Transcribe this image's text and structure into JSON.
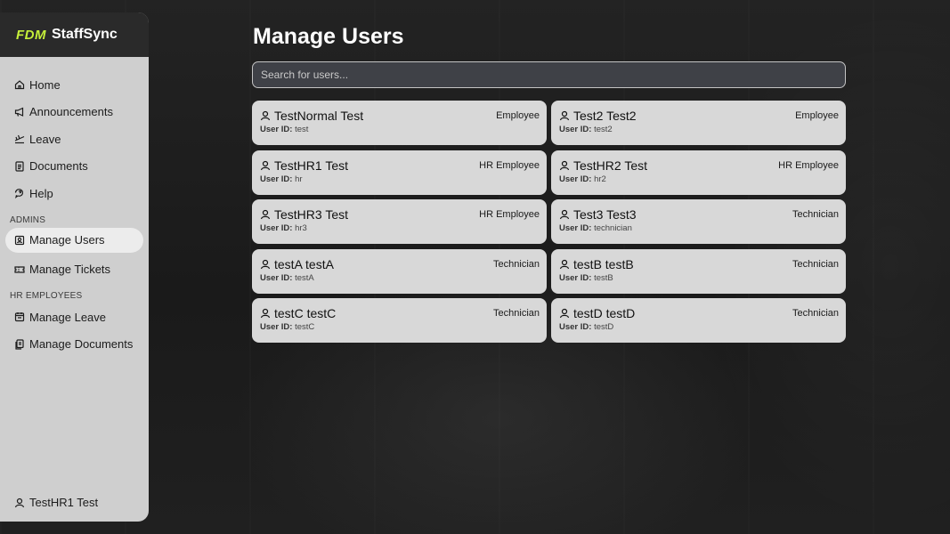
{
  "brand": {
    "logo": "FDM",
    "name": "StaffSync",
    "logo_color": "#c6f03a"
  },
  "sidebar": {
    "main_items": [
      {
        "label": "Home",
        "icon": "home-icon"
      },
      {
        "label": "Announcements",
        "icon": "megaphone-icon"
      },
      {
        "label": "Leave",
        "icon": "plane-icon"
      },
      {
        "label": "Documents",
        "icon": "document-icon"
      },
      {
        "label": "Help",
        "icon": "help-icon"
      }
    ],
    "admins_label": "ADMINS",
    "admin_items": [
      {
        "label": "Manage Users",
        "icon": "users-icon",
        "active": true
      },
      {
        "label": "Manage Tickets",
        "icon": "ticket-icon"
      }
    ],
    "hr_label": "HR EMPLOYEES",
    "hr_items": [
      {
        "label": "Manage Leave",
        "icon": "calendar-icon"
      },
      {
        "label": "Manage Documents",
        "icon": "documents-icon"
      }
    ],
    "current_user": "TestHR1 Test"
  },
  "main": {
    "title": "Manage Users",
    "search": {
      "placeholder": "Search for users...",
      "value": ""
    },
    "user_id_label": "User ID:",
    "users": [
      {
        "name": "TestNormal Test",
        "role": "Employee",
        "id": "test"
      },
      {
        "name": "Test2 Test2",
        "role": "Employee",
        "id": "test2"
      },
      {
        "name": "TestHR1 Test",
        "role": "HR Employee",
        "id": "hr"
      },
      {
        "name": "TestHR2 Test",
        "role": "HR Employee",
        "id": "hr2"
      },
      {
        "name": "TestHR3 Test",
        "role": "HR Employee",
        "id": "hr3"
      },
      {
        "name": "Test3 Test3",
        "role": "Technician",
        "id": "technician"
      },
      {
        "name": "testA testA",
        "role": "Technician",
        "id": "testA"
      },
      {
        "name": "testB testB",
        "role": "Technician",
        "id": "testB"
      },
      {
        "name": "testC testC",
        "role": "Technician",
        "id": "testC"
      },
      {
        "name": "testD testD",
        "role": "Technician",
        "id": "testD"
      }
    ]
  }
}
